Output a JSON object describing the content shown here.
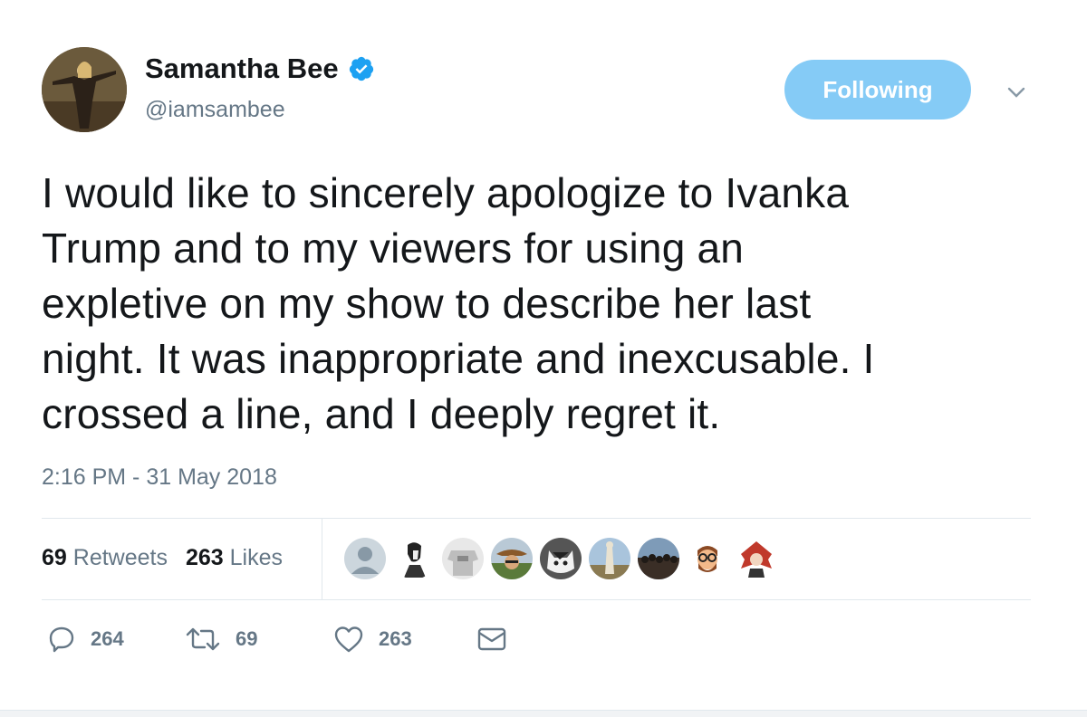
{
  "user": {
    "name": "Samantha Bee",
    "handle": "@iamsambee",
    "verified": true
  },
  "follow_button": {
    "label": "Following",
    "color": "#85cbf6"
  },
  "tweet": {
    "lines": [
      "I would like to sincerely apologize to Ivanka",
      "Trump and to my viewers for using an",
      "expletive on my show to describe her last",
      "night. It was inappropriate and inexcusable. I",
      "crossed a line, and I deeply regret it."
    ],
    "timestamp": "2:16 PM - 31 May 2018"
  },
  "stats": {
    "retweets_count": "69",
    "retweets_label": "Retweets",
    "likes_count": "263",
    "likes_label": "Likes"
  },
  "likers": [
    "default-avatar",
    "portrait-sketch",
    "gray-sweater",
    "cowboy-hat",
    "cat",
    "figure-outdoors",
    "crowd",
    "emoji-glasses",
    "anime-character"
  ],
  "actions": {
    "replies": "264",
    "retweets": "69",
    "likes": "263"
  },
  "colors": {
    "accent": "#1da1f2",
    "muted": "#657786",
    "text": "#14171a"
  }
}
